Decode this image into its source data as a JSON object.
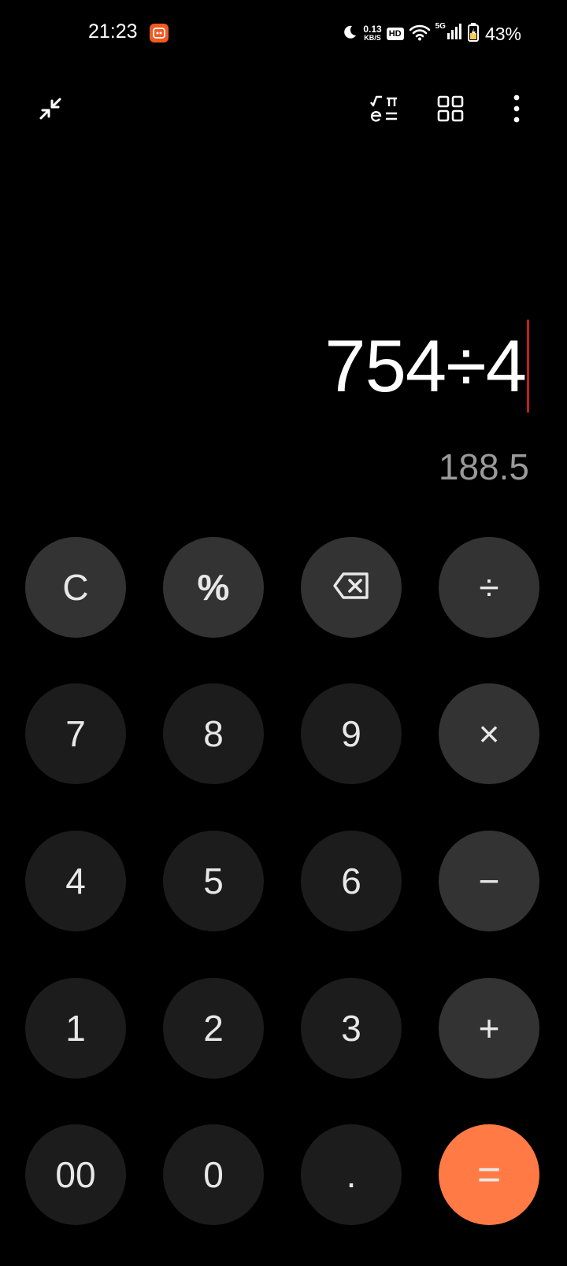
{
  "status_bar": {
    "time": "21:23",
    "net_speed_value": "0.13",
    "net_speed_unit": "KB/S",
    "hd_label": "HD",
    "network_type": "5G",
    "battery": "43%"
  },
  "display": {
    "expression": "754÷4",
    "result": "188.5"
  },
  "keys": {
    "clear": "C",
    "percent": "%",
    "divide": "÷",
    "seven": "7",
    "eight": "8",
    "nine": "9",
    "multiply": "×",
    "four": "4",
    "five": "5",
    "six": "6",
    "minus": "−",
    "one": "1",
    "two": "2",
    "three": "3",
    "plus": "+",
    "double_zero": "00",
    "zero": "0",
    "decimal": ".",
    "equals": "="
  },
  "colors": {
    "background": "#000000",
    "digit_key": "#1c1c1c",
    "operator_key": "#333333",
    "equals_key": "#ff7a45",
    "cursor": "#c0201a",
    "result_text": "#9a9a9a"
  },
  "icons": {
    "collapse": "collapse-icon",
    "scientific": "scientific-mode-icon",
    "converter": "converter-grid-icon",
    "more": "more-vertical-icon",
    "backspace": "backspace-icon"
  }
}
